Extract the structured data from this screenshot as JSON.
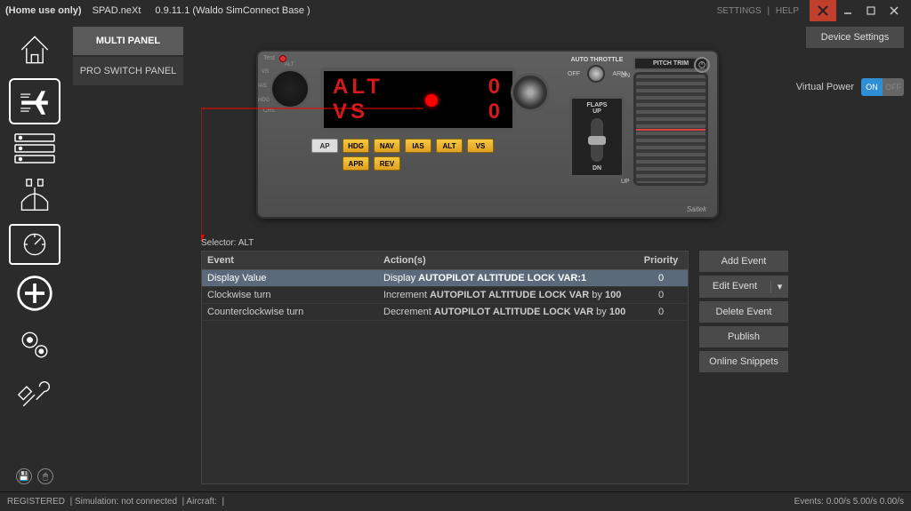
{
  "titlebar": {
    "home_use": "(Home use only)",
    "app_name": "SPAD.neXt",
    "version_profile": "0.9.11.1 (Waldo SimConnect Base )",
    "settings": "SETTINGS",
    "help": "HELP"
  },
  "tabs": {
    "multi_panel": "MULTI PANEL",
    "pro_switch_panel": "PRO SWITCH PANEL"
  },
  "topright": {
    "device_settings": "Device Settings",
    "virtual_power": "Virtual Power",
    "vp_on": "ON",
    "vp_off": "OFF"
  },
  "device": {
    "lcd_line1_left": "ALT",
    "lcd_line1_right": "0",
    "lcd_line2_left": "VS",
    "lcd_line2_right": "0",
    "sel_labels": {
      "alt": "ALT",
      "vs": "VS",
      "ias": "IAS",
      "hdg": "HDG",
      "crs": "CRS"
    },
    "btn_ap": "AP",
    "btn_hdg": "HDG",
    "btn_nav": "NAV",
    "btn_ias": "IAS",
    "btn_alt": "ALT",
    "btn_vs": "VS",
    "btn_apr": "APR",
    "btn_rev": "REV",
    "auto_throttle": "AUTO THROTTLE",
    "off": "OFF",
    "arm": "ARM",
    "flaps": "FLAPS",
    "flaps_up": "UP",
    "flaps_dn": "DN",
    "pitch_trim": "PITCH TRIM",
    "pitch_dn": "DN",
    "pitch_up": "UP",
    "brand": "Saitek",
    "test": "Test"
  },
  "selector_label": "Selector: ALT",
  "grid": {
    "hdr_event": "Event",
    "hdr_action": "Action(s)",
    "hdr_priority": "Priority",
    "rows": [
      {
        "event": "Display Value",
        "action_prefix": "Display ",
        "action_bold": "AUTOPILOT ALTITUDE LOCK VAR:1",
        "action_suffix": "",
        "priority": "0",
        "selected": true
      },
      {
        "event": "Clockwise turn",
        "action_prefix": "Increment ",
        "action_bold": "AUTOPILOT ALTITUDE LOCK VAR",
        "action_suffix": " by ",
        "action_bold2": "100",
        "priority": "0",
        "selected": false
      },
      {
        "event": "Counterclockwise turn",
        "action_prefix": "Decrement ",
        "action_bold": "AUTOPILOT ALTITUDE LOCK VAR",
        "action_suffix": " by ",
        "action_bold2": "100",
        "priority": "0",
        "selected": false
      }
    ]
  },
  "actions": {
    "add_event": "Add Event",
    "edit_event": "Edit Event",
    "delete_event": "Delete Event",
    "publish": "Publish",
    "online_snippets": "Online Snippets"
  },
  "footer": {
    "registered": "REGISTERED",
    "sim": "| Simulation: not connected",
    "aircraft": "| Aircraft:",
    "pipe": " | ",
    "events": "Events: 0.00/s 5.00/s 0.00/s"
  }
}
